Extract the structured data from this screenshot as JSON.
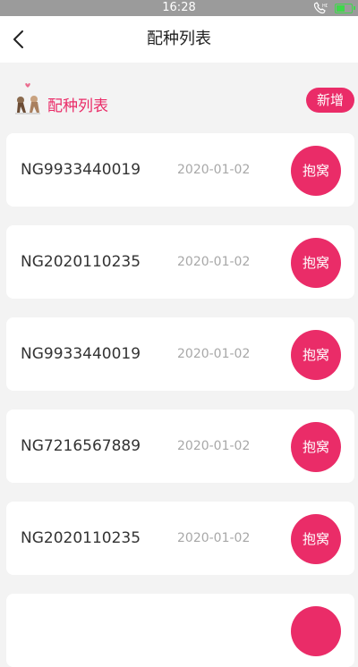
{
  "status_bar": {
    "time": "16:28"
  },
  "nav": {
    "title": "配种列表"
  },
  "section": {
    "title": "配种列表",
    "add_label": "新增"
  },
  "records": [
    {
      "code": "NG9933440019",
      "date": "2020-01-02",
      "action": "抱窝"
    },
    {
      "code": "NG2020110235",
      "date": "2020-01-02",
      "action": "抱窝"
    },
    {
      "code": "NG9933440019",
      "date": "2020-01-02",
      "action": "抱窝"
    },
    {
      "code": "NG7216567889",
      "date": "2020-01-02",
      "action": "抱窝"
    },
    {
      "code": "NG2020110235",
      "date": "2020-01-02",
      "action": "抱窝"
    },
    {
      "code": "",
      "date": "",
      "action": ""
    }
  ],
  "colors": {
    "accent": "#ea2c68",
    "status_bar": "#9b9b9b",
    "battery": "#3ed94a"
  },
  "icons": {
    "back": "chevron-left-icon",
    "section": "dogs-icon",
    "call": "phone-hd-icon",
    "battery": "battery-icon"
  }
}
